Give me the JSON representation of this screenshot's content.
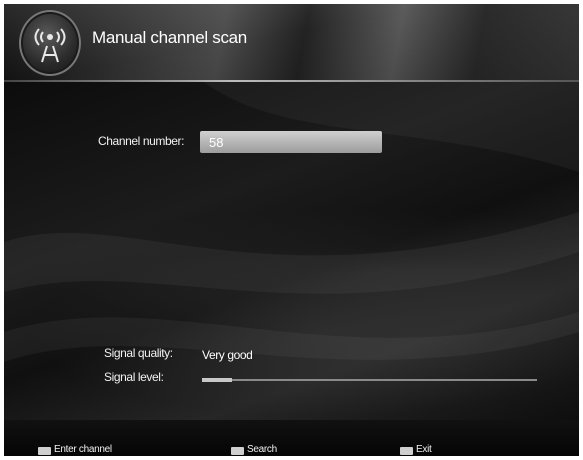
{
  "header": {
    "title": "Manual channel scan",
    "logo_icon": "antenna-signal-icon"
  },
  "channel": {
    "label": "Channel number:",
    "value": "58"
  },
  "signal": {
    "quality_label": "Signal quality:",
    "quality_value": "Very good",
    "level_label": "Signal level:",
    "level_fraction": 0.09
  },
  "footer": {
    "items": [
      {
        "key_icon": "numeric-keys-icon",
        "label": "Enter channel"
      },
      {
        "key_icon": "ok-key-icon",
        "label": "Search"
      },
      {
        "key_icon": "menu-key-icon",
        "label": "Exit"
      }
    ]
  },
  "colors": {
    "background": "#000000",
    "text": "#ffffff",
    "field": "#a8a8a8",
    "bar_track": "#8a8a8a",
    "bar_fill": "#c8c8c8"
  }
}
